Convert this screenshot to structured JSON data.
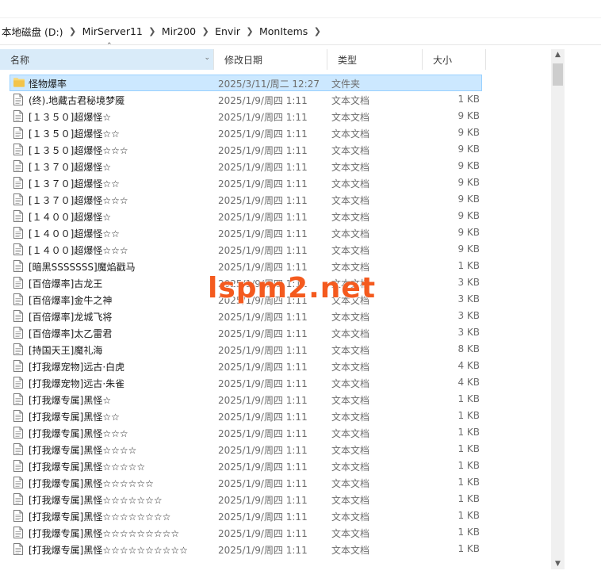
{
  "breadcrumb": [
    "本地磁盘 (D:)",
    "MirServer11",
    "Mir200",
    "Envir",
    "MonItems"
  ],
  "columns": {
    "name": "名称",
    "date": "修改日期",
    "type": "类型",
    "size": "大小"
  },
  "watermark": "lspm2.net",
  "files": [
    {
      "name": "怪物爆率",
      "date": "2025/3/11/周二 12:27",
      "type": "文件夹",
      "size": "",
      "folder": true,
      "selected": true
    },
    {
      "name": "(终).地藏古君秘境梦魇",
      "date": "2025/1/9/周四 1:11",
      "type": "文本文档",
      "size": "1 KB"
    },
    {
      "name": "[１３５０]超爆怪☆",
      "date": "2025/1/9/周四 1:11",
      "type": "文本文档",
      "size": "9 KB"
    },
    {
      "name": "[１３５０]超爆怪☆☆",
      "date": "2025/1/9/周四 1:11",
      "type": "文本文档",
      "size": "9 KB"
    },
    {
      "name": "[１３５０]超爆怪☆☆☆",
      "date": "2025/1/9/周四 1:11",
      "type": "文本文档",
      "size": "9 KB"
    },
    {
      "name": "[１３７０]超爆怪☆",
      "date": "2025/1/9/周四 1:11",
      "type": "文本文档",
      "size": "9 KB"
    },
    {
      "name": "[１３７０]超爆怪☆☆",
      "date": "2025/1/9/周四 1:11",
      "type": "文本文档",
      "size": "9 KB"
    },
    {
      "name": "[１３７０]超爆怪☆☆☆",
      "date": "2025/1/9/周四 1:11",
      "type": "文本文档",
      "size": "9 KB"
    },
    {
      "name": "[１４００]超爆怪☆",
      "date": "2025/1/9/周四 1:11",
      "type": "文本文档",
      "size": "9 KB"
    },
    {
      "name": "[１４００]超爆怪☆☆",
      "date": "2025/1/9/周四 1:11",
      "type": "文本文档",
      "size": "9 KB"
    },
    {
      "name": "[１４００]超爆怪☆☆☆",
      "date": "2025/1/9/周四 1:11",
      "type": "文本文档",
      "size": "9 KB"
    },
    {
      "name": "[暗黑SSSSSSS]魔焰戳马",
      "date": "2025/1/9/周四 1:11",
      "type": "文本文档",
      "size": "1 KB"
    },
    {
      "name": "[百倍爆率]古龙王",
      "date": "2025/1/9/周四 1:11",
      "type": "文本文档",
      "size": "3 KB"
    },
    {
      "name": "[百倍爆率]金牛之神",
      "date": "2025/1/9/周四 1:11",
      "type": "文本文档",
      "size": "3 KB"
    },
    {
      "name": "[百倍爆率]龙城飞将",
      "date": "2025/1/9/周四 1:11",
      "type": "文本文档",
      "size": "3 KB"
    },
    {
      "name": "[百倍爆率]太乙雷君",
      "date": "2025/1/9/周四 1:11",
      "type": "文本文档",
      "size": "3 KB"
    },
    {
      "name": "[持国天王]魔礼海",
      "date": "2025/1/9/周四 1:11",
      "type": "文本文档",
      "size": "8 KB"
    },
    {
      "name": "[打我爆宠物]远古·白虎",
      "date": "2025/1/9/周四 1:11",
      "type": "文本文档",
      "size": "4 KB"
    },
    {
      "name": "[打我爆宠物]远古·朱雀",
      "date": "2025/1/9/周四 1:11",
      "type": "文本文档",
      "size": "4 KB"
    },
    {
      "name": "[打我爆专属]黑怪☆",
      "date": "2025/1/9/周四 1:11",
      "type": "文本文档",
      "size": "1 KB"
    },
    {
      "name": "[打我爆专属]黑怪☆☆",
      "date": "2025/1/9/周四 1:11",
      "type": "文本文档",
      "size": "1 KB"
    },
    {
      "name": "[打我爆专属]黑怪☆☆☆",
      "date": "2025/1/9/周四 1:11",
      "type": "文本文档",
      "size": "1 KB"
    },
    {
      "name": "[打我爆专属]黑怪☆☆☆☆",
      "date": "2025/1/9/周四 1:11",
      "type": "文本文档",
      "size": "1 KB"
    },
    {
      "name": "[打我爆专属]黑怪☆☆☆☆☆",
      "date": "2025/1/9/周四 1:11",
      "type": "文本文档",
      "size": "1 KB"
    },
    {
      "name": "[打我爆专属]黑怪☆☆☆☆☆☆",
      "date": "2025/1/9/周四 1:11",
      "type": "文本文档",
      "size": "1 KB"
    },
    {
      "name": "[打我爆专属]黑怪☆☆☆☆☆☆☆",
      "date": "2025/1/9/周四 1:11",
      "type": "文本文档",
      "size": "1 KB"
    },
    {
      "name": "[打我爆专属]黑怪☆☆☆☆☆☆☆☆",
      "date": "2025/1/9/周四 1:11",
      "type": "文本文档",
      "size": "1 KB"
    },
    {
      "name": "[打我爆专属]黑怪☆☆☆☆☆☆☆☆☆",
      "date": "2025/1/9/周四 1:11",
      "type": "文本文档",
      "size": "1 KB"
    },
    {
      "name": "[打我爆专属]黑怪☆☆☆☆☆☆☆☆☆☆",
      "date": "2025/1/9/周四 1:11",
      "type": "文本文档",
      "size": "1 KB"
    }
  ]
}
